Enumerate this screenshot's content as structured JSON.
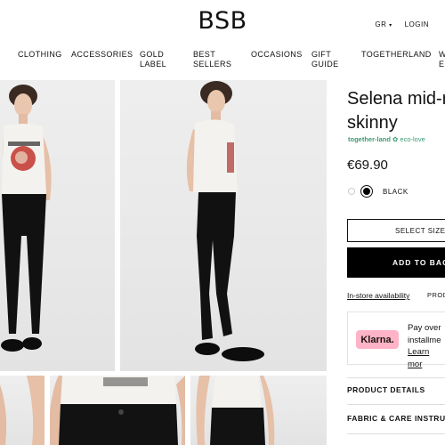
{
  "header": {
    "logo": "BSB",
    "lang": "GR",
    "login": "LOGIN"
  },
  "nav": {
    "clothing": "CLOTHING",
    "accessories": "ACCESSORIES",
    "gold_label": [
      "GOLD",
      "LABEL"
    ],
    "best_sellers": [
      "BEST",
      "SELLERS"
    ],
    "occasions": "OCCASIONS",
    "gift_guide": [
      "GIFT",
      "GUIDE"
    ],
    "togetherland": "TOGETHERLAND",
    "cut_item": [
      "W",
      "E"
    ]
  },
  "product": {
    "title_line1": "Selena mid-r",
    "title_line2": "skinny",
    "eco_badge": "together-land",
    "eco_sub": "eco-love",
    "price": "€69.90",
    "color": "BLACK",
    "select_size": "SELECT SIZE",
    "add_to_bag": "ADD TO BAG",
    "in_store": "In-store availability",
    "prod_tab": "PROD",
    "klarna": {
      "brand": "Klarna.",
      "line1": "Pay over",
      "line2": "installme",
      "line3": "Learn mor"
    },
    "sections": [
      "PRODUCT DETAILS",
      "FABRIC & CARE INSTRUC"
    ]
  },
  "colors": {
    "klarna_pink": "#ffb3c7",
    "eco_green": "#3f9a74",
    "button_black": "#000000"
  }
}
